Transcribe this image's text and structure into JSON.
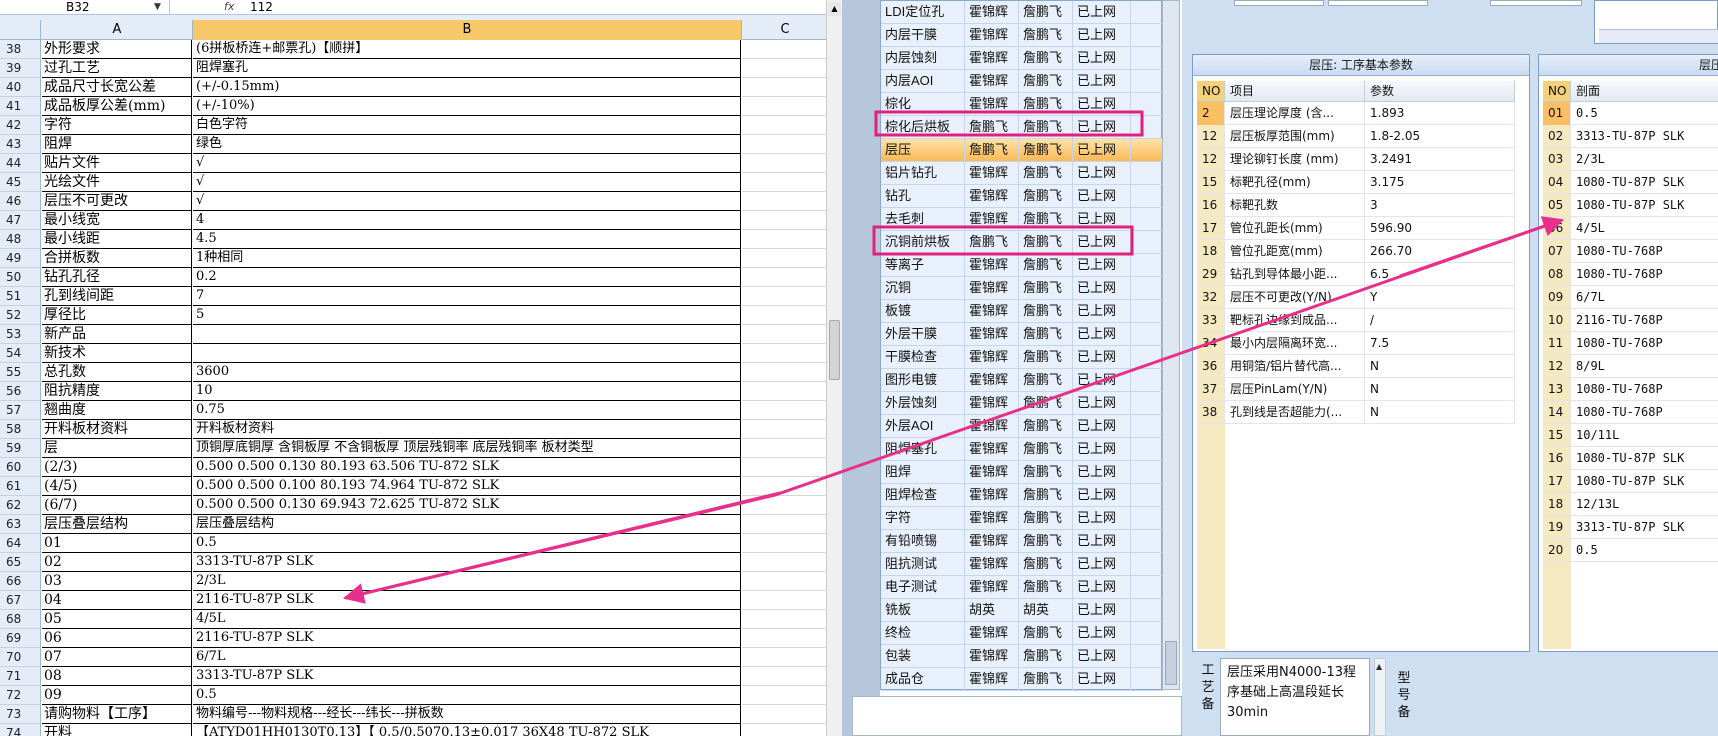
{
  "formula_bar": {
    "name_box": "B32",
    "fx_label": "fx",
    "value": "112"
  },
  "spreadsheet": {
    "columns": [
      "A",
      "B",
      "C"
    ],
    "rows": [
      {
        "n": "38",
        "a": "外形要求",
        "b": "(6拼板桥连+邮票孔)【顺拼】"
      },
      {
        "n": "39",
        "a": "过孔工艺",
        "b": "阻焊塞孔"
      },
      {
        "n": "40",
        "a": "成品尺寸长宽公差",
        "b": "(+/-0.15mm)"
      },
      {
        "n": "41",
        "a": "成品板厚公差(mm)",
        "b": "(+/-10%)"
      },
      {
        "n": "42",
        "a": "字符",
        "b": "白色字符"
      },
      {
        "n": "43",
        "a": "阻焊",
        "b": "绿色"
      },
      {
        "n": "44",
        "a": "贴片文件",
        "b": "√"
      },
      {
        "n": "45",
        "a": "光绘文件",
        "b": "√"
      },
      {
        "n": "46",
        "a": "层压不可更改",
        "b": "√"
      },
      {
        "n": "47",
        "a": "最小线宽",
        "b": "4"
      },
      {
        "n": "48",
        "a": "最小线距",
        "b": "4.5"
      },
      {
        "n": "49",
        "a": "合拼板数",
        "b": "1种相同"
      },
      {
        "n": "50",
        "a": "钻孔孔径",
        "b": "0.2"
      },
      {
        "n": "51",
        "a": "孔到线间距",
        "b": "7"
      },
      {
        "n": "52",
        "a": "厚径比",
        "b": "5"
      },
      {
        "n": "53",
        "a": "新产品",
        "b": ""
      },
      {
        "n": "54",
        "a": "新技术",
        "b": ""
      },
      {
        "n": "55",
        "a": "总孔数",
        "b": "3600"
      },
      {
        "n": "56",
        "a": "阻抗精度",
        "b": "10"
      },
      {
        "n": "57",
        "a": "翘曲度",
        "b": "0.75"
      },
      {
        "n": "58",
        "a": "开料板材资料",
        "b": "开料板材资料"
      },
      {
        "n": "59",
        "a": "层",
        "b": "顶铜厚底铜厚 含铜板厚 不含铜板厚 顶层残铜率 底层残铜率 板材类型"
      },
      {
        "n": "60",
        "a": "(2/3)",
        "b": "0.500  0.500         0.130       80.193     63.506      TU-872 SLK"
      },
      {
        "n": "61",
        "a": "(4/5)",
        "b": "0.500  0.500         0.100       80.193     74.964      TU-872 SLK"
      },
      {
        "n": "62",
        "a": "(6/7)",
        "b": "0.500  0.500         0.130       69.943     72.625      TU-872 SLK"
      },
      {
        "n": "63",
        "a": "层压叠层结构",
        "b": "层压叠层结构"
      },
      {
        "n": "64",
        "a": "01",
        "b": "0.5"
      },
      {
        "n": "65",
        "a": "02",
        "b": "3313-TU-87P SLK"
      },
      {
        "n": "66",
        "a": "03",
        "b": "2/3L"
      },
      {
        "n": "67",
        "a": "04",
        "b": "2116-TU-87P SLK"
      },
      {
        "n": "68",
        "a": "05",
        "b": "4/5L"
      },
      {
        "n": "69",
        "a": "06",
        "b": "2116-TU-87P SLK"
      },
      {
        "n": "70",
        "a": "07",
        "b": "6/7L"
      },
      {
        "n": "71",
        "a": "08",
        "b": "3313-TU-87P SLK"
      },
      {
        "n": "72",
        "a": "09",
        "b": "0.5"
      },
      {
        "n": "73",
        "a": "请购物料【工序】",
        "b": "物料编号---物料规格---经长---纬长---拼板数"
      },
      {
        "n": "74",
        "a": "开料",
        "b": "【ATYD01HH0130T0.13】【 0.5/0.5070.13±0.017 36X48  TU-872 SLK"
      }
    ]
  },
  "process_list": {
    "rows": [
      [
        "LDI定位孔",
        "霍锦辉",
        "詹鹏飞",
        "已上网"
      ],
      [
        "内层干膜",
        "霍锦辉",
        "詹鹏飞",
        "已上网"
      ],
      [
        "内层蚀刻",
        "霍锦辉",
        "詹鹏飞",
        "已上网"
      ],
      [
        "内层AOI",
        "霍锦辉",
        "詹鹏飞",
        "已上网"
      ],
      [
        "棕化",
        "霍锦辉",
        "詹鹏飞",
        "已上网"
      ],
      [
        "棕化后烘板",
        "詹鹏飞",
        "詹鹏飞",
        "已上网"
      ],
      [
        "层压",
        "詹鹏飞",
        "詹鹏飞",
        "已上网"
      ],
      [
        "铝片钻孔",
        "霍锦辉",
        "詹鹏飞",
        "已上网"
      ],
      [
        "钻孔",
        "霍锦辉",
        "詹鹏飞",
        "已上网"
      ],
      [
        "去毛刺",
        "霍锦辉",
        "詹鹏飞",
        "已上网"
      ],
      [
        "沉铜前烘板",
        "詹鹏飞",
        "詹鹏飞",
        "已上网"
      ],
      [
        "等离子",
        "霍锦辉",
        "詹鹏飞",
        "已上网"
      ],
      [
        "沉铜",
        "霍锦辉",
        "詹鹏飞",
        "已上网"
      ],
      [
        "板镀",
        "霍锦辉",
        "詹鹏飞",
        "已上网"
      ],
      [
        "外层干膜",
        "霍锦辉",
        "詹鹏飞",
        "已上网"
      ],
      [
        "干膜检查",
        "霍锦辉",
        "詹鹏飞",
        "已上网"
      ],
      [
        "图形电镀",
        "霍锦辉",
        "詹鹏飞",
        "已上网"
      ],
      [
        "外层蚀刻",
        "霍锦辉",
        "詹鹏飞",
        "已上网"
      ],
      [
        "外层AOI",
        "霍锦辉",
        "詹鹏飞",
        "已上网"
      ],
      [
        "阻焊塞孔",
        "霍锦辉",
        "詹鹏飞",
        "已上网"
      ],
      [
        "阻焊",
        "霍锦辉",
        "詹鹏飞",
        "已上网"
      ],
      [
        "阻焊检查",
        "霍锦辉",
        "詹鹏飞",
        "已上网"
      ],
      [
        "字符",
        "霍锦辉",
        "詹鹏飞",
        "已上网"
      ],
      [
        "有铅喷锡",
        "霍锦辉",
        "詹鹏飞",
        "已上网"
      ],
      [
        "阻抗测试",
        "霍锦辉",
        "詹鹏飞",
        "已上网"
      ],
      [
        "电子测试",
        "霍锦辉",
        "詹鹏飞",
        "已上网"
      ],
      [
        "铣板",
        "胡英",
        "胡英",
        "已上网"
      ],
      [
        "终检",
        "霍锦辉",
        "詹鹏飞",
        "已上网"
      ],
      [
        "包装",
        "霍锦辉",
        "詹鹏飞",
        "已上网"
      ],
      [
        "成品仓",
        "霍锦辉",
        "詹鹏飞",
        "已上网"
      ]
    ]
  },
  "params_panel": {
    "title": "层压: 工序基本参数",
    "headers": [
      "NO",
      "项目",
      "参数"
    ],
    "rows": [
      [
        "2",
        "层压理论厚度 (含...",
        "1.893"
      ],
      [
        "12",
        "层压板厚范围(mm)",
        "1.8-2.05"
      ],
      [
        "12",
        "理论铆钉长度 (mm)",
        "3.2491"
      ],
      [
        "15",
        "标靶孔径(mm)",
        "3.175"
      ],
      [
        "16",
        "标靶孔数",
        "3"
      ],
      [
        "17",
        "管位孔距长(mm)",
        "596.90"
      ],
      [
        "18",
        "管位孔距宽(mm)",
        "266.70"
      ],
      [
        "29",
        "钻孔到导体最小距...",
        "6.5"
      ],
      [
        "32",
        "层压不可更改(Y/N)",
        "Y"
      ],
      [
        "33",
        "靶标孔边缘到成品...",
        "/"
      ],
      [
        "34",
        "最小内层隔离环宽...",
        "7.5"
      ],
      [
        "36",
        "用铜箔/铝片替代高...",
        "N"
      ],
      [
        "37",
        "层压PinLam(Y/N)",
        "N"
      ],
      [
        "38",
        "孔到线是否超能力(...",
        "N"
      ]
    ]
  },
  "stack_panel": {
    "title": "层压",
    "headers": [
      "NO",
      "剖面"
    ],
    "rows": [
      [
        "01",
        "0.5"
      ],
      [
        "02",
        "3313-TU-87P SLK"
      ],
      [
        "03",
        "2/3L"
      ],
      [
        "04",
        "1080-TU-87P SLK"
      ],
      [
        "05",
        "1080-TU-87P SLK"
      ],
      [
        "06",
        "4/5L"
      ],
      [
        "07",
        "1080-TU-768P"
      ],
      [
        "08",
        "1080-TU-768P"
      ],
      [
        "09",
        "6/7L"
      ],
      [
        "10",
        "2116-TU-768P"
      ],
      [
        "11",
        "1080-TU-768P"
      ],
      [
        "12",
        "8/9L"
      ],
      [
        "13",
        "1080-TU-768P"
      ],
      [
        "14",
        "1080-TU-768P"
      ],
      [
        "15",
        "10/11L"
      ],
      [
        "16",
        "1080-TU-87P SLK"
      ],
      [
        "17",
        "1080-TU-87P SLK"
      ],
      [
        "18",
        "12/13L"
      ],
      [
        "19",
        "3313-TU-87P SLK"
      ],
      [
        "20",
        "0.5"
      ]
    ]
  },
  "bottom": {
    "label_left": "工艺备",
    "note": "层压采用N4000-13程序基础上高温段延长30min",
    "label_right": "型号备"
  },
  "colors": {
    "highlight_box": "#e0207f",
    "arrow": "#e8308a",
    "selected_row": "#fbbf63"
  }
}
